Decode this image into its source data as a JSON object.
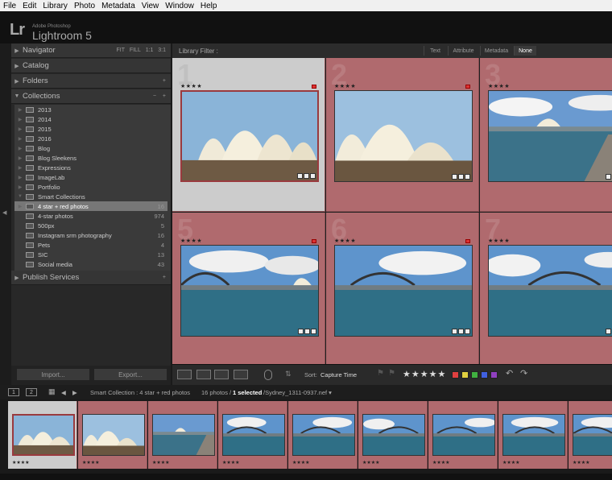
{
  "menu": [
    "File",
    "Edit",
    "Library",
    "Photo",
    "Metadata",
    "View",
    "Window",
    "Help"
  ],
  "identity": {
    "logo": "Lr",
    "company": "Adobe Photoshop",
    "product": "Lightroom 5"
  },
  "navigator": {
    "label": "Navigator",
    "zoom_options": [
      "FIT",
      "FILL",
      "1:1",
      "3:1"
    ]
  },
  "panels": {
    "catalog": "Catalog",
    "folders": "Folders",
    "collections": "Collections",
    "publish": "Publish Services",
    "folders_action": "+",
    "collections_minus": "−",
    "collections_plus": "+",
    "publish_action": "+"
  },
  "collections": [
    {
      "label": "2013",
      "count": ""
    },
    {
      "label": "2014",
      "count": ""
    },
    {
      "label": "2015",
      "count": ""
    },
    {
      "label": "2016",
      "count": ""
    },
    {
      "label": "Blog",
      "count": ""
    },
    {
      "label": "Blog Sleekens",
      "count": ""
    },
    {
      "label": "Expressions",
      "count": ""
    },
    {
      "label": "ImageLab",
      "count": ""
    },
    {
      "label": "Portfolio",
      "count": ""
    },
    {
      "label": "Smart Collections",
      "count": ""
    },
    {
      "label": "4 star + red photos",
      "count": "16",
      "selected": true
    },
    {
      "label": "4-star photos",
      "count": "974"
    },
    {
      "label": "500px",
      "count": "5"
    },
    {
      "label": "Instagram srm photography",
      "count": "16"
    },
    {
      "label": "Pets",
      "count": "4"
    },
    {
      "label": "SIC",
      "count": "13"
    },
    {
      "label": "Social media",
      "count": "43"
    }
  ],
  "buttons": {
    "import": "Import...",
    "export": "Export..."
  },
  "filter": {
    "label": "Library Filter :",
    "tabs": [
      "Text",
      "Attribute",
      "Metadata",
      "None"
    ],
    "active": "None"
  },
  "grid": {
    "cells": [
      {
        "num": "1",
        "stars": "★★★★",
        "scene": "opera"
      },
      {
        "num": "2",
        "stars": "★★★★",
        "scene": "opera"
      },
      {
        "num": "3",
        "stars": "★★★★",
        "scene": "harbour"
      },
      {
        "num": "5",
        "stars": "★★★★",
        "scene": "bridge"
      },
      {
        "num": "6",
        "stars": "★★★★",
        "scene": "bridge"
      },
      {
        "num": "7",
        "stars": "★★★★",
        "scene": "bridge"
      }
    ]
  },
  "toolbar": {
    "sort_label": "Sort:",
    "sort_value": "Capture Time",
    "rating": "★★★★★",
    "colors": [
      "#e04040",
      "#e0d040",
      "#40b040",
      "#4060e0",
      "#9040c0"
    ]
  },
  "filmstrip_header": {
    "screen1": "1",
    "screen2": "2",
    "source": "Smart Collection : 4 star + red photos",
    "count": "16 photos /",
    "selected": "1 selected",
    "filename": "/Sydney_1311-0937.nef ▾"
  },
  "filmstrip": [
    {
      "scene": "opera",
      "stars": "★★★★"
    },
    {
      "scene": "opera",
      "stars": "★★★★"
    },
    {
      "scene": "harbour",
      "stars": "★★★★"
    },
    {
      "scene": "bridge",
      "stars": "★★★★"
    },
    {
      "scene": "bridge",
      "stars": "★★★★"
    },
    {
      "scene": "bridge",
      "stars": "★★★★"
    },
    {
      "scene": "bridge",
      "stars": "★★★★"
    },
    {
      "scene": "bridge",
      "stars": "★★★★"
    },
    {
      "scene": "bridge",
      "stars": "★★★★"
    }
  ]
}
